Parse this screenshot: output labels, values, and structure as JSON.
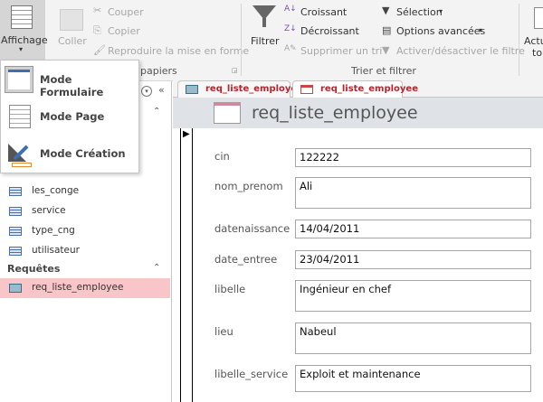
{
  "ribbon": {
    "view_button": "Affichage",
    "paste": "Coller",
    "cut": "Couper",
    "copy": "Copier",
    "format_painter": "Reproduire la mise en forme",
    "clipboard_group": "papiers",
    "filter": "Filtrer",
    "ascending": "Croissant",
    "descending": "Décroissant",
    "remove_sort": "Supprimer un tri",
    "selection": "Sélection",
    "advanced": "Options avancées",
    "toggle_filter": "Activer/désactiver le filtre",
    "sort_group": "Trier et filtrer",
    "refresh_line1": "Actu",
    "refresh_line2": "to"
  },
  "view_menu": {
    "items": [
      {
        "label": "Mode Formulaire"
      },
      {
        "label": "Mode Page"
      },
      {
        "label": "Mode Création"
      }
    ]
  },
  "nav": {
    "items": [
      {
        "label": "les_conge"
      },
      {
        "label": "service"
      },
      {
        "label": "type_cng"
      },
      {
        "label": "utilisateur"
      }
    ],
    "queries_header": "Requêtes",
    "queries": [
      {
        "label": "req_liste_employee"
      }
    ]
  },
  "tabs": [
    {
      "label": "req_liste_employee"
    },
    {
      "label": "req_liste_employee"
    }
  ],
  "form": {
    "title": "req_liste_employee",
    "fields": [
      {
        "label": "cin",
        "value": "122222"
      },
      {
        "label": "nom_prenom",
        "value": "Ali"
      },
      {
        "label": "datenaissance",
        "value": "14/04/2011"
      },
      {
        "label": "date_entree",
        "value": "23/04/2011"
      },
      {
        "label": "libelle",
        "value": "Ingénieur en chef"
      },
      {
        "label": "lieu",
        "value": "Nabeul"
      },
      {
        "label": "libelle_service",
        "value": "Exploit et maintenance"
      }
    ]
  },
  "colors": {
    "active_query_bg": "#f8c5c8",
    "tab_text": "#b5252e",
    "header_band": "#dfe3e8"
  }
}
